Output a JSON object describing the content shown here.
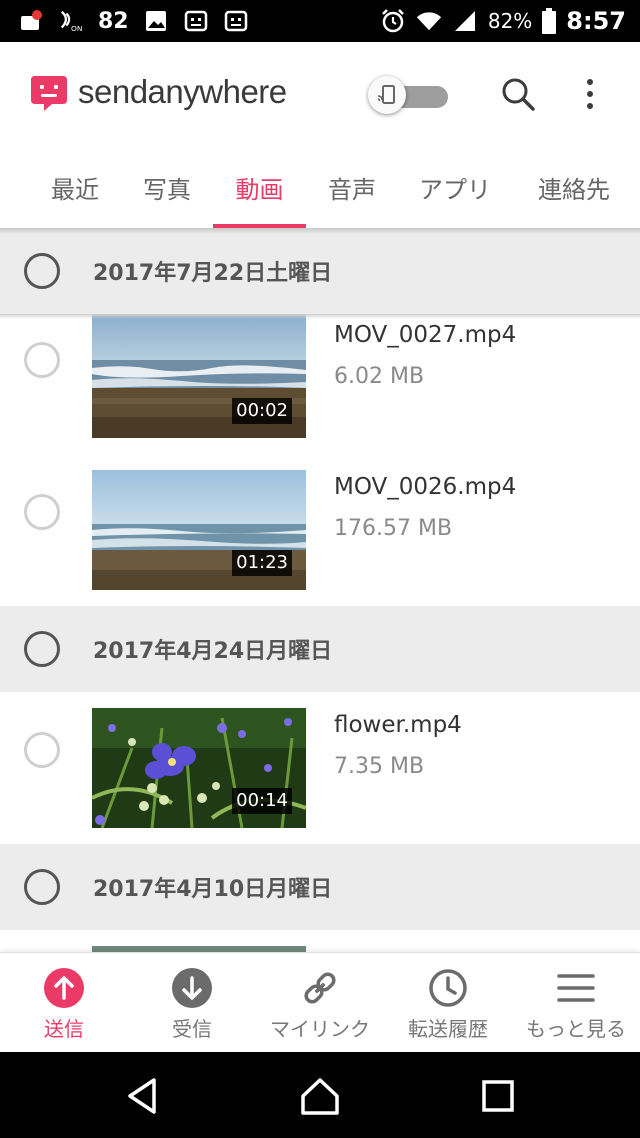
{
  "status_bar": {
    "notification_count": "82",
    "battery_percent": "82%",
    "time": "8:57"
  },
  "header": {
    "logo_text": "sendanywhere",
    "brand_color": "#ec3a66"
  },
  "tabs": [
    {
      "label": "最近",
      "active": false
    },
    {
      "label": "写真",
      "active": false
    },
    {
      "label": "動画",
      "active": true
    },
    {
      "label": "音声",
      "active": false
    },
    {
      "label": "アプリ",
      "active": false
    },
    {
      "label": "連絡先",
      "active": false
    }
  ],
  "groups": [
    {
      "date": "2017年7月22日土曜日",
      "items": [
        {
          "name": "MOV_0027.mp4",
          "size": "6.02 MB",
          "duration": "00:02"
        },
        {
          "name": "MOV_0026.mp4",
          "size": "176.57 MB",
          "duration": "01:23"
        }
      ]
    },
    {
      "date": "2017年4月24日月曜日",
      "items": [
        {
          "name": "flower.mp4",
          "size": "7.35 MB",
          "duration": "00:14"
        }
      ]
    },
    {
      "date": "2017年4月10日月曜日",
      "items": []
    }
  ],
  "bottom_nav": [
    {
      "label": "送信",
      "icon": "send-up-arrow-icon",
      "active": true
    },
    {
      "label": "受信",
      "icon": "receive-down-arrow-icon",
      "active": false
    },
    {
      "label": "マイリンク",
      "icon": "link-icon",
      "active": false
    },
    {
      "label": "転送履歴",
      "icon": "clock-icon",
      "active": false
    },
    {
      "label": "もっと見る",
      "icon": "menu-icon",
      "active": false
    }
  ]
}
